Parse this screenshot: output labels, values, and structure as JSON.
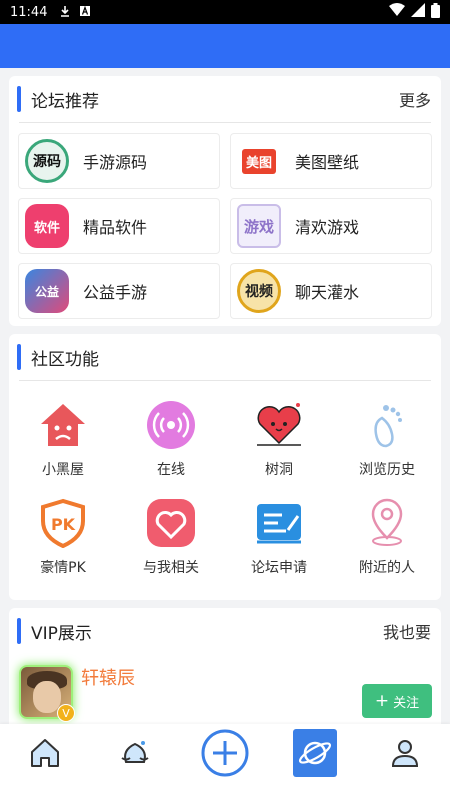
{
  "status_bar": {
    "time": "11:44"
  },
  "forum_section": {
    "title": "论坛推荐",
    "more": "更多",
    "items": [
      {
        "label": "手游源码",
        "icon_text": "源码",
        "icon": "source-code-icon",
        "color": "#3aa77a"
      },
      {
        "label": "美图壁纸",
        "icon_text": "美图",
        "icon": "wallpaper-icon",
        "color": "#e9432d"
      },
      {
        "label": "精品软件",
        "icon_text": "软件",
        "icon": "software-icon",
        "color": "#ee3f6e"
      },
      {
        "label": "清欢游戏",
        "icon_text": "游戏",
        "icon": "game-icon",
        "color": "#8e74c9"
      },
      {
        "label": "公益手游",
        "icon_text": "公益",
        "icon": "charity-game-icon",
        "color": "#3a86e0"
      },
      {
        "label": "聊天灌水",
        "icon_text": "视频",
        "icon": "chat-icon",
        "color": "#e0a51c"
      }
    ]
  },
  "community_section": {
    "title": "社区功能",
    "items": [
      {
        "label": "小黑屋",
        "icon": "house-sad-icon",
        "color": "#e8575b"
      },
      {
        "label": "在线",
        "icon": "online-broadcast-icon",
        "color": "#e27be0"
      },
      {
        "label": "树洞",
        "icon": "heart-icon",
        "color": "#e83e4a"
      },
      {
        "label": "浏览历史",
        "icon": "footprint-icon",
        "color": "#9ec3e8"
      },
      {
        "label": "豪情PK",
        "icon": "pk-shield-icon",
        "color": "#f07a2e"
      },
      {
        "label": "与我相关",
        "icon": "heart-box-icon",
        "color": "#f05c6e"
      },
      {
        "label": "论坛申请",
        "icon": "apply-form-icon",
        "color": "#2a8fe0"
      },
      {
        "label": "附近的人",
        "icon": "location-pin-icon",
        "color": "#e68fae"
      }
    ]
  },
  "vip_section": {
    "title": "VIP展示",
    "more": "我也要",
    "user": {
      "name": "轩辕辰",
      "badge": "V"
    },
    "follow_label": "关注",
    "follow_plus": "+"
  },
  "bottom_nav": {
    "items": [
      {
        "icon": "home-icon"
      },
      {
        "icon": "community-icon"
      },
      {
        "icon": "add-post-icon"
      },
      {
        "icon": "planet-icon"
      },
      {
        "icon": "profile-icon"
      }
    ]
  },
  "colors": {
    "accent": "#2f6df6",
    "follow_button": "#3fbf7f",
    "vip_name": "#f27b3b"
  }
}
